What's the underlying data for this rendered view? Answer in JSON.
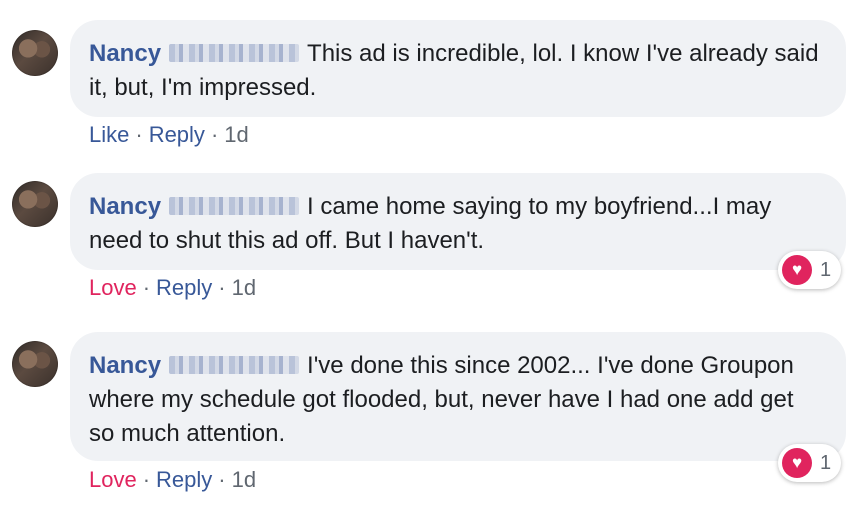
{
  "comments": [
    {
      "name": "Nancy",
      "text": "This ad is incredible, lol. I know I've already said it, but, I'm impressed.",
      "reaction_label": "Like",
      "reply_label": "Reply",
      "time": "1d",
      "reaction_count": ""
    },
    {
      "name": "Nancy",
      "text": "I came home saying to my boyfriend...I may need to shut this ad off. But I haven't.",
      "reaction_label": "Love",
      "reply_label": "Reply",
      "time": "1d",
      "reaction_count": "1",
      "reaction_icon": "heart-icon"
    },
    {
      "name": "Nancy",
      "text": "I've done this since 2002... I've done Groupon where my schedule got flooded, but, never have I had one add get so much attention.",
      "reaction_label": "Love",
      "reply_label": "Reply",
      "time": "1d",
      "reaction_count": "1",
      "reaction_icon": "heart-icon"
    }
  ],
  "separator": "·",
  "colors": {
    "link": "#385898",
    "love": "#e0245e",
    "bubble": "#f0f2f5",
    "meta": "#606770"
  }
}
